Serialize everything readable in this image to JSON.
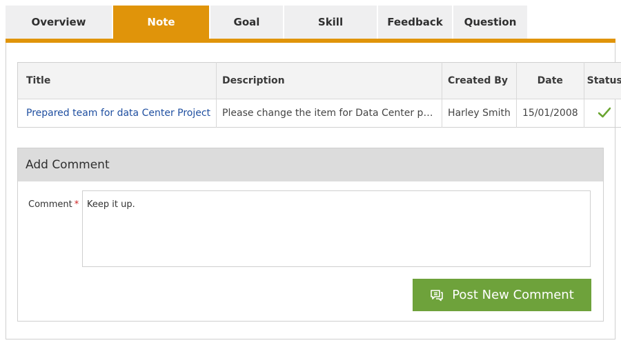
{
  "tabs": [
    {
      "label": "Overview",
      "active": false
    },
    {
      "label": "Note",
      "active": true
    },
    {
      "label": "Goal",
      "active": false
    },
    {
      "label": "Skill",
      "active": false
    },
    {
      "label": "Feedback",
      "active": false
    },
    {
      "label": "Question",
      "active": false
    }
  ],
  "table": {
    "headers": {
      "title": "Title",
      "description": "Description",
      "created_by": "Created By",
      "date": "Date",
      "status": "Status"
    },
    "rows": [
      {
        "title": "Prepared team for data Center Project",
        "description": "Please change the item for Data Center project...",
        "created_by": "Harley Smith",
        "date": "15/01/2008",
        "status_icon": "checkmark-icon"
      }
    ]
  },
  "comment": {
    "header": "Add Comment",
    "label": "Comment",
    "required_marker": "*",
    "value": "Keep it up.",
    "button_label": "Post New Comment",
    "button_icon": "comment-icon"
  },
  "colors": {
    "accent": "#e0940a",
    "button": "#6ea23b",
    "link": "#1f4fa0",
    "status_ok": "#6aa531"
  }
}
